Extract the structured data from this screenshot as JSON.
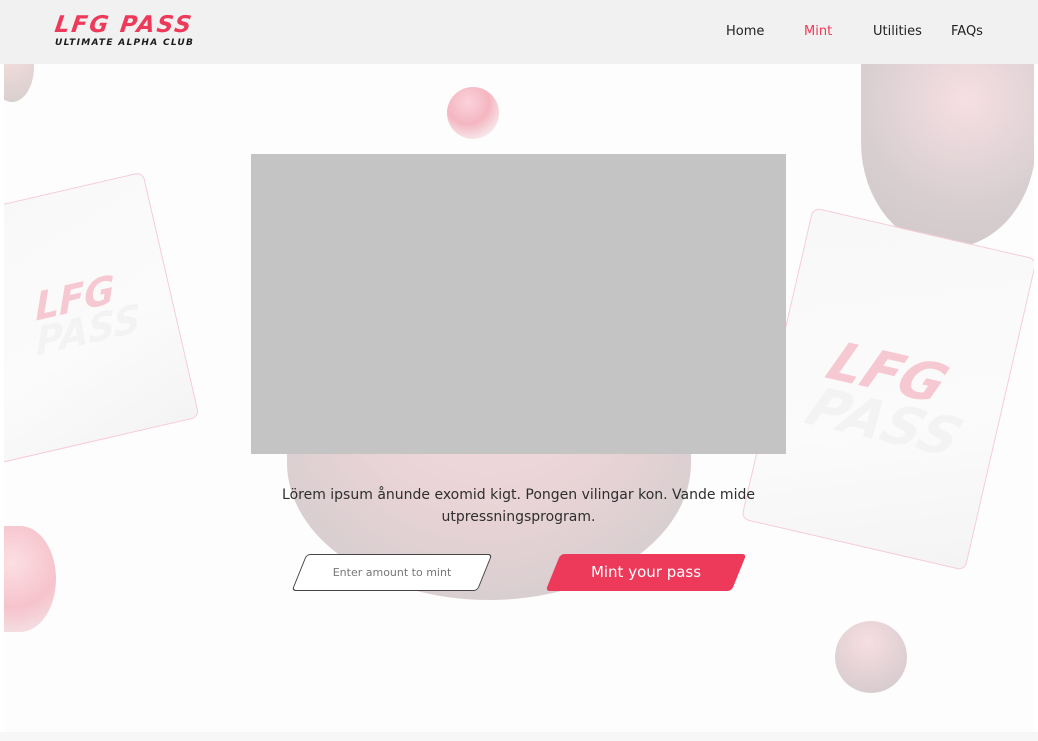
{
  "header": {
    "logo_title": "LFG PASS",
    "logo_subtitle": "ULTIMATE ALPHA CLUB",
    "nav": [
      {
        "label": "Home",
        "active": false
      },
      {
        "label": "Mint",
        "active": true
      },
      {
        "label": "Utilities",
        "active": false
      },
      {
        "label": "FAQs",
        "active": false
      }
    ]
  },
  "cards": {
    "left": {
      "line1": "LFG",
      "line2": "PASS"
    },
    "right": {
      "line1": "LFG",
      "line2": "PASS"
    }
  },
  "main": {
    "description": "Lörem ipsum ånunde exomid kigt. Pongen vilingar kon. Vande mide utpressningsprogram.",
    "amount_input": {
      "value": "",
      "placeholder": "Enter amount to mint"
    },
    "mint_button_label": "Mint your pass"
  },
  "colors": {
    "accent": "#ee3a5a",
    "header_bg": "#f1f1f1",
    "placeholder_gray": "#c4c4c4"
  }
}
